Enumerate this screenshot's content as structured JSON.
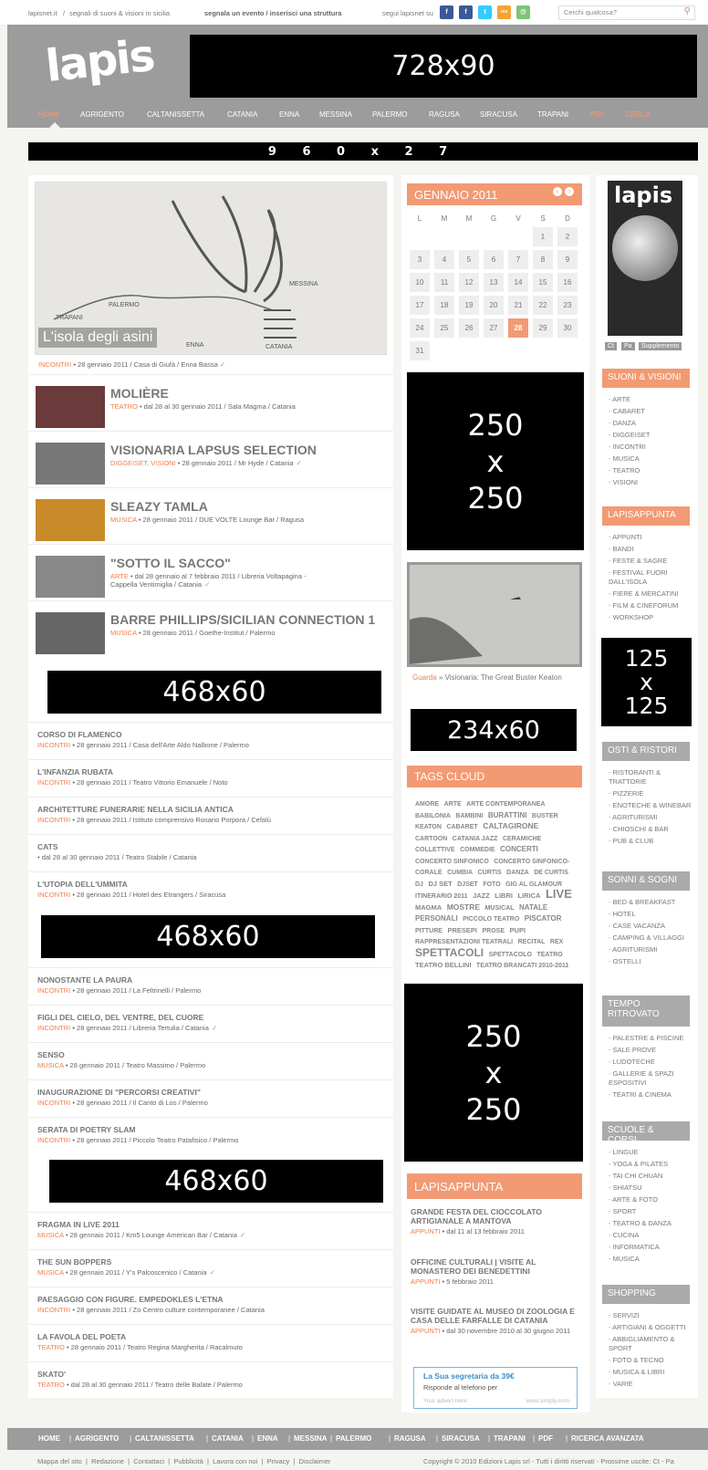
{
  "topbar": {
    "site": "lapisnet.it",
    "sep": "/",
    "tagline": "segnali di suoni & visioni in sicilia",
    "submit": "segnala un evento / inserisci una struttura",
    "follow": "segui lapisnet su",
    "search_placeholder": "Cerchi qualcosa?",
    "social": [
      "f",
      "f",
      "t",
      "rss",
      "@"
    ]
  },
  "header": {
    "logo": "lapis",
    "ad_top": "728x90"
  },
  "nav": {
    "items": [
      "HOME",
      "AGRIGENTO",
      "CALTANISSETTA",
      "CATANIA",
      "ENNA",
      "MESSINA",
      "PALERMO",
      "RAGUSA",
      "SIRACUSA",
      "TRAPANI",
      "PDF",
      "CERCA"
    ]
  },
  "ad_wide": "9 6 0 x 2 7",
  "featured": {
    "caption": "L'isola degli asini",
    "cat": "INCONTRI",
    "meta": " • 28 gennaio 2011 / Casa di Giufà / Enna Bassa",
    "map_labels": [
      "MESSINA",
      "PALERMO",
      "TRAPANI",
      "ENNA",
      "CATANIA"
    ]
  },
  "events": [
    {
      "title": "MOLIÈRE",
      "cat": "TEATRO",
      "meta": " • dal 28 al 30 gennaio 2011 / Sala Magma / Catania",
      "check": ""
    },
    {
      "title": "VISIONARIA LAPSUS SELECTION",
      "cat": "DIGGEISET, VISIONI",
      "meta": " • 28 gennaio 2011 / Mr Hyde / Catania",
      "check": "✓"
    },
    {
      "title": "SLEAZY TAMLA",
      "cat": "MUSICA",
      "meta": " • 28 gennaio 2011 / DUE VOLTE Lounge Bar / Ragusa",
      "check": ""
    },
    {
      "title": "\"SOTTO IL SACCO\"",
      "cat": "ARTE",
      "meta": " • dal 28 gennaio al 7 febbraio 2011 / Libreria Voltapagina -",
      "meta2": "Cappella Ventimiglia / Catania",
      "check": "✓"
    },
    {
      "title": "BARRE PHILLIPS/SICILIAN CONNECTION 1",
      "cat": "MUSICA",
      "meta": " • 28 gennaio 2011 / Goethe-Institut / Palermo",
      "check": ""
    }
  ],
  "ad_468": "468x60",
  "list1": [
    {
      "title": "CORSO DI FLAMENCO",
      "cat": "INCONTRI",
      "meta": " • 28 gennaio 2011 / Casa dell'Arte Aldo Nalbone / Palermo",
      "check": ""
    },
    {
      "title": "L'INFANZIA RUBATA",
      "cat": "INCONTRI",
      "meta": " • 28 gennaio 2011 / Teatro Vittorio Emanuele / Noto",
      "check": ""
    },
    {
      "title": "ARCHITETTURE FUNERARIE NELLA SICILIA ANTICA",
      "cat": "INCONTRI",
      "meta": " • 28 gennaio 2011 / Istituto comprensivo Rosario Porpora / Cefalù",
      "check": ""
    },
    {
      "title": "CATS",
      "cat": "",
      "meta": " • dal 28 al 30 gennaio 2011 / Teatro Stabile / Catania",
      "check": ""
    },
    {
      "title": "L'UTOPIA DELL'UMMITA",
      "cat": "INCONTRI",
      "meta": " • 28 gennaio 2011 / Hotel des Etrangers / Siracusa",
      "check": ""
    }
  ],
  "list2": [
    {
      "title": "NONOSTANTE LA PAURA",
      "cat": "INCONTRI",
      "meta": " • 28 gennaio 2011 / La Feltrinelli / Palermo",
      "check": ""
    },
    {
      "title": "FIGLI DEL CIELO, DEL VENTRE, DEL CUORE",
      "cat": "INCONTRI",
      "meta": " • 28 gennaio 2011 / Libreria Tertulia / Catania",
      "check": "✓"
    },
    {
      "title": "SENSO",
      "cat": "MUSICA",
      "meta": " • 28 gennaio 2011 / Teatro Massimo / Palermo",
      "check": ""
    },
    {
      "title": "INAUGURAZIONE DI \"PERCORSI CREATIVI\"",
      "cat": "INCONTRI",
      "meta": " • 28 gennaio 2011 / Il Canto di Los / Palermo",
      "check": ""
    },
    {
      "title": "SERATA DI POETRY SLAM",
      "cat": "INCONTRI",
      "meta": " • 28 gennaio 2011 / Piccolo Teatro Patafisico / Palermo",
      "check": ""
    }
  ],
  "list3": [
    {
      "title": "FRAGMA IN LIVE 2011",
      "cat": "MUSICA",
      "meta": " • 28 gennaio 2011 / Km5 Lounge American Bar / Catania",
      "check": "✓"
    },
    {
      "title": "THE SUN BOPPERS",
      "cat": "MUSICA",
      "meta": " • 28 gennaio 2011 / Y's Palcoscenico / Catania",
      "check": "✓"
    },
    {
      "title": "PAESAGGIO CON FIGURE. EMPEDOKLES L'ETNA",
      "cat": "INCONTRI",
      "meta": " • 28 gennaio 2011 / Zo Centro culture contemporanee / Catania",
      "check": ""
    },
    {
      "title": "LA FAVOLA DEL POETA",
      "cat": "TEATRO",
      "meta": " • 28 gennaio 2011 / Teatro Regina Margherita / Racalmuto",
      "check": ""
    },
    {
      "title": "SKATO'",
      "cat": "TEATRO",
      "meta": " • dal 28 al 30 gennaio 2011 / Teatro delle Balate / Palermo",
      "check": ""
    }
  ],
  "calendar": {
    "title": "GENNAIO 2011",
    "days": [
      "L",
      "M",
      "M",
      "G",
      "V",
      "S",
      "D"
    ],
    "cells": [
      "",
      "",
      "",
      "",
      "",
      "1",
      "2",
      "3",
      "4",
      "5",
      "6",
      "7",
      "8",
      "9",
      "10",
      "11",
      "12",
      "13",
      "14",
      "15",
      "16",
      "17",
      "18",
      "19",
      "20",
      "21",
      "22",
      "23",
      "24",
      "25",
      "26",
      "27",
      "28",
      "29",
      "30",
      "31"
    ],
    "today": "28"
  },
  "ad_250": "250\nx\n250",
  "video": {
    "link": "Guarda",
    "text": " » Visionaria: The Great Buster Keaton"
  },
  "ad_234": "234x60",
  "tags": {
    "title": "TAGS CLOUD",
    "items": [
      [
        "AMORE",
        7
      ],
      [
        "ARTE",
        7
      ],
      [
        "ARTE CONTEMPORANEA",
        7
      ],
      [
        "BABILONIA",
        7
      ],
      [
        "BAMBINI",
        7
      ],
      [
        "BURATTINI",
        8
      ],
      [
        "BUSTER KEATON",
        7
      ],
      [
        "CABARET",
        7
      ],
      [
        "CALTAGIRONE",
        8.5
      ],
      [
        "CARTOON",
        7
      ],
      [
        "CATANIA JAZZ",
        7
      ],
      [
        "CERAMICHE",
        7
      ],
      [
        "COLLETTIVE",
        7
      ],
      [
        "COMMEDIE",
        7
      ],
      [
        "CONCERTI",
        8
      ],
      [
        "CONCERTO SINFONICO",
        7
      ],
      [
        "CONCERTO SINFONICO-CORALE",
        7
      ],
      [
        "CUMBIA",
        7
      ],
      [
        "CURTIS",
        7
      ],
      [
        "DANZA",
        7
      ],
      [
        "DE CURTIS",
        7
      ],
      [
        "DJ",
        7
      ],
      [
        "DJ SET",
        7.5
      ],
      [
        "DJSET",
        7
      ],
      [
        "FOTO",
        7
      ],
      [
        "GIG AL GLAMOUR",
        7
      ],
      [
        "ITINERARIO 2011",
        7
      ],
      [
        "JAZZ",
        7.5
      ],
      [
        "LIBRI",
        7.5
      ],
      [
        "LIRICA",
        7.5
      ],
      [
        "LIVE",
        13
      ],
      [
        "MAGMA",
        7.5
      ],
      [
        "MOSTRE",
        8.5
      ],
      [
        "MUSICAL",
        7
      ],
      [
        "NATALE",
        8
      ],
      [
        "PERSONALI",
        8
      ],
      [
        "PICCOLO TEATRO",
        7
      ],
      [
        "PISCATOR",
        8
      ],
      [
        "PITTURE",
        7
      ],
      [
        "PRESEPI",
        7.5
      ],
      [
        "PROSE",
        7
      ],
      [
        "PUPI",
        7.5
      ],
      [
        "RAPPRESENTAZIONI TEATRALI",
        7
      ],
      [
        "RECITAL",
        7
      ],
      [
        "REX",
        7
      ],
      [
        "SPETTACOLI",
        12
      ],
      [
        "SPETTACOLO",
        7
      ],
      [
        "TEATRO",
        7
      ],
      [
        "TEATRO BELLINI",
        7.5
      ],
      [
        "TEATRO BRANCATI 2010-2011",
        7
      ]
    ]
  },
  "appunta": {
    "title": "LAPISAPPUNTA",
    "items": [
      {
        "title": "GRANDE FESTA DEL CIOCCOLATO ARTIGIANALE A MANTOVA",
        "cat": "APPUNTI",
        "meta": " • dal 11 al 13 febbraio 2011"
      },
      {
        "title": "OFFICINE CULTURALI | VISITE AL MONASTERO DEI BENEDETTINI",
        "cat": "APPUNTI",
        "meta": " • 5 febbraio 2011"
      },
      {
        "title": "VISITE GUIDATE AL MUSEO DI ZOOLOGIA E CASA DELLE FARFALLE DI CATANIA",
        "cat": "APPUNTI",
        "meta": " • dal 30 novembre 2010 al 30 giugno 2011"
      }
    ]
  },
  "textad": {
    "title": "La Sua segretaria da 39€",
    "line": "Risponde al telefono per",
    "left": "Your advert here",
    "right": "www.simply.com"
  },
  "right": {
    "mag_tabs": [
      "Ct",
      "Pa",
      "Supplemento"
    ],
    "suoni": {
      "title": "SUONI & VISIONI",
      "items": [
        "ARTE",
        "CABARET",
        "DANZA",
        "DIGGEISET",
        "INCONTRI",
        "MUSICA",
        "TEATRO",
        "VISIONI"
      ]
    },
    "lapisappunta": {
      "title": "LAPISAPPUNTA",
      "items": [
        "APPUNTI",
        "BANDI",
        "FESTE & SAGRE",
        "FESTIVAL FUORI DALL'ISOLA",
        "FIERE & MERCATINI",
        "FILM & CINEFORUM",
        "WORKSHOP"
      ]
    },
    "ad_125": "125\nx\n125",
    "osti": {
      "title": "OSTI & RISTORI",
      "items": [
        "RISTORANTI & TRATTORIE",
        "PIZZERIE",
        "ENOTECHE & WINEBAR",
        "AGRITURISMI",
        "CHIOSCHI & BAR",
        "PUB & CLUB"
      ]
    },
    "sonni": {
      "title": "SONNI & SOGNI",
      "items": [
        "BED & BREAKFAST",
        "HOTEL",
        "CASE VACANZA",
        "CAMPING & VILLAGGI",
        "AGRITURISMI",
        "OSTELLI"
      ]
    },
    "tempo": {
      "title": "TEMPO RITROVATO",
      "items": [
        "PALESTRE & PISCINE",
        "SALE PROVE",
        "LUDOTECHE",
        "GALLERIE & SPAZI ESPOSITIVI",
        "TEATRI & CINEMA"
      ]
    },
    "scuole": {
      "title": "SCUOLE & CORSI",
      "items": [
        "LINGUE",
        "YOGA & PILATES",
        "TAI CHI CHUAN",
        "SHIATSU",
        "ARTE & FOTO",
        "SPORT",
        "TEATRO & DANZA",
        "CUCINA",
        "INFORMATICA",
        "MUSICA"
      ]
    },
    "shopping": {
      "title": "SHOPPING",
      "items": [
        "SERVIZI",
        "ARTIGIANI & OGGETTI",
        "ABBIGLIAMENTO & SPORT",
        "FOTO & TECNO",
        "MUSICA & LIBRI",
        "VARIE"
      ]
    }
  },
  "footer": {
    "items": [
      "HOME",
      "AGRIGENTO",
      "CALTANISSETTA",
      "CATANIA",
      "ENNA",
      "MESSINA",
      "PALERMO",
      "RAGUSA",
      "SIRACUSA",
      "TRAPANI",
      "PDF",
      "RICERCA AVANZATA"
    ]
  },
  "bottom": {
    "links": [
      "Mappa del sito",
      "Redazione",
      "Contattaci",
      "Pubblicità",
      "Lavora con noi",
      "Privacy",
      "Disclaimer"
    ],
    "copyright": "Copyright © 2010 Edizioni Lapis srl - Tutti i diritti riservati - Prossime uscite: Ct - Pa"
  }
}
